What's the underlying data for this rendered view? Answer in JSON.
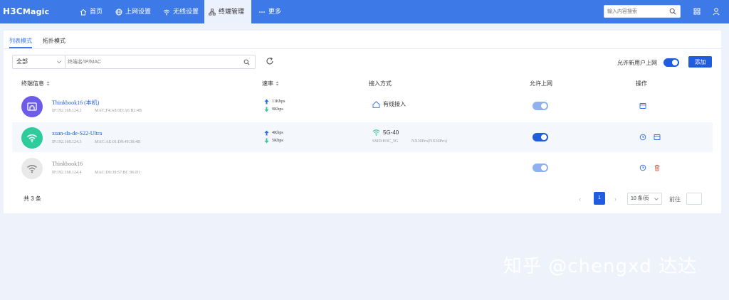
{
  "app": {
    "logo_main": "H3C",
    "logo_sub": "Magic"
  },
  "nav": [
    {
      "label": "首页",
      "icon": "home-icon"
    },
    {
      "label": "上网设置",
      "icon": "globe-icon"
    },
    {
      "label": "无线设置",
      "icon": "wifi-icon"
    },
    {
      "label": "终端管理",
      "icon": "devices-icon",
      "active": true
    },
    {
      "label": "更多",
      "icon": "more-icon"
    }
  ],
  "search": {
    "placeholder": "输入内容搜索"
  },
  "tabs": [
    {
      "label": "列表模式",
      "active": true
    },
    {
      "label": "拓扑模式"
    }
  ],
  "filter": {
    "scope": "全部",
    "placeholder": "终端名/IP/MAC"
  },
  "allow_new_user": {
    "label": "允许新用户上网",
    "enabled": true
  },
  "add_button": "添加",
  "table": {
    "headers": [
      "终端信息",
      "速率",
      "接入方式",
      "允许上网",
      "操作"
    ],
    "rows": [
      {
        "name": "Thinkbook16 (本机)",
        "ip": "IP:192.168.124.2",
        "mac": "MAC:F4:A8:0D:A6:B2:4B",
        "up": "11Kbps",
        "down": "9Kbps",
        "access": "有线接入",
        "access_icon": "home-outline-icon",
        "allowed": true,
        "avatar_color": "#6c5ce7",
        "avatar_icon": "wired-port-icon"
      },
      {
        "name": "xuan-da-de-S22-Ultra",
        "ip": "IP:192.168.124.3",
        "mac": "MAC:AE:01:D9:49:38:4B",
        "up": "4Kbps",
        "down": "5Kbps",
        "access": "5G-40",
        "access_icon": "wifi-icon",
        "ssid": "SSID:H3C_5G",
        "band": "NX30Pro(NX30Pro)",
        "allowed": true,
        "avatar_color": "#2ecc9a",
        "avatar_icon": "wifi-icon"
      },
      {
        "name": "Thinkbook16",
        "ip": "IP:192.168.124.4",
        "mac": "MAC:D0:39:57:BC:96:D1",
        "allowed": true,
        "avatar_color": "#e9e9e9",
        "avatar_icon": "wifi-icon"
      }
    ]
  },
  "pagination": {
    "total": "共 3 条",
    "current": "1",
    "page_size": "10 条/页",
    "goto": "前往"
  },
  "watermark": "知乎 @chengxd 达达",
  "colors": {
    "primary": "#1f5ce0",
    "topbar": "#3d7ae8"
  }
}
